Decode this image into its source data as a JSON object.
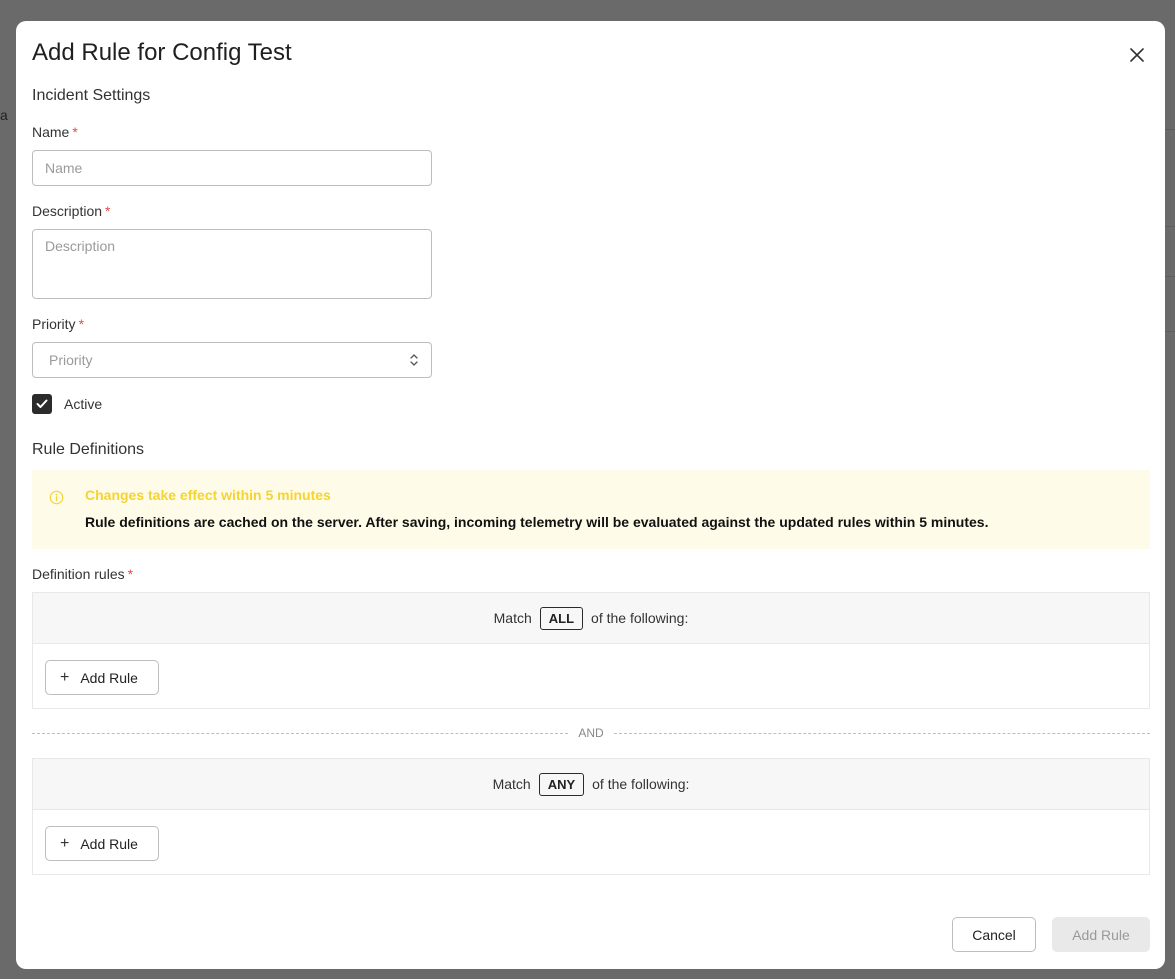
{
  "background": {
    "fragment_text": "a"
  },
  "modal": {
    "title": "Add Rule for Config Test"
  },
  "incident_settings": {
    "heading": "Incident Settings",
    "name": {
      "label": "Name",
      "required_mark": "*",
      "placeholder": "Name",
      "value": ""
    },
    "description": {
      "label": "Description",
      "required_mark": "*",
      "placeholder": "Description",
      "value": ""
    },
    "priority": {
      "label": "Priority",
      "required_mark": "*",
      "placeholder": "Priority"
    },
    "active": {
      "label": "Active",
      "checked": true
    }
  },
  "rule_definitions": {
    "heading": "Rule Definitions",
    "alert": {
      "title": "Changes take effect within 5 minutes",
      "body": "Rule definitions are cached on the server. After saving, incoming telemetry will be evaluated against the updated rules within 5 minutes.",
      "icon": "info-icon",
      "title_color": "#f5d332",
      "background_color": "#fefce8"
    },
    "definition_label": "Definition rules",
    "required_mark": "*",
    "groups": [
      {
        "match_prefix": "Match",
        "match_mode": "ALL",
        "match_suffix": "of the following:",
        "add_rule_label": "Add Rule"
      },
      {
        "match_prefix": "Match",
        "match_mode": "ANY",
        "match_suffix": "of the following:",
        "add_rule_label": "Add Rule"
      }
    ],
    "group_joiner": "AND"
  },
  "footer": {
    "cancel_label": "Cancel",
    "submit_label": "Add Rule"
  }
}
